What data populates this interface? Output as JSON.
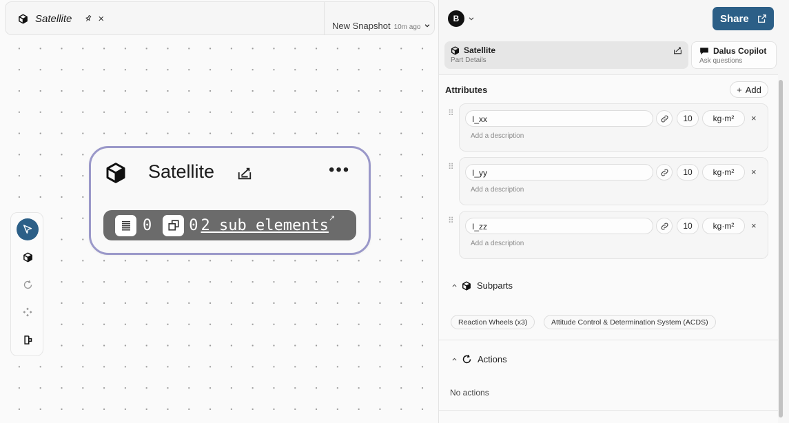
{
  "canvas": {
    "tab": {
      "title": "Satellite",
      "icon": "cube-icon",
      "pin_icon": "pin-icon",
      "close_label": "×"
    },
    "snapshot": {
      "name": "New Snapshot",
      "time": "10m ago",
      "chevron": "⌄"
    },
    "node": {
      "title": "Satellite",
      "more_label": "•••",
      "attributes_count": "0",
      "parts_count": "0",
      "subelements_label": "2 sub elements",
      "external_link": "↗"
    },
    "toolbar": [
      "select-tool",
      "cube-tool",
      "refresh-tool",
      "move-tool",
      "exit-tool"
    ]
  },
  "panel": {
    "avatar_letter": "B",
    "share_label": "Share",
    "tabs": [
      {
        "title": "Satellite",
        "subtitle": "Part Details",
        "icon": "cube-icon"
      },
      {
        "title": "Dalus Copilot",
        "subtitle": "Ask questions",
        "icon": "chat-icon"
      }
    ],
    "attributes": {
      "title": "Attributes",
      "add_label": "Add",
      "items": [
        {
          "name": "I_xx",
          "value": "10",
          "unit": "kg·m²",
          "desc_placeholder": "Add a description"
        },
        {
          "name": "I_yy",
          "value": "10",
          "unit": "kg·m²",
          "desc_placeholder": "Add a description"
        },
        {
          "name": "I_zz",
          "value": "10",
          "unit": "kg·m²",
          "desc_placeholder": "Add a description"
        }
      ]
    },
    "subparts": {
      "title": "Subparts",
      "chips": [
        "Reaction Wheels (x3)",
        "Attitude Control & Determination System (ACDS)"
      ]
    },
    "actions": {
      "title": "Actions",
      "empty_label": "No actions"
    }
  },
  "colors": {
    "accent": "#2c5f87",
    "node_border": "#9a98c9",
    "node_bar": "#6b6b6b"
  }
}
